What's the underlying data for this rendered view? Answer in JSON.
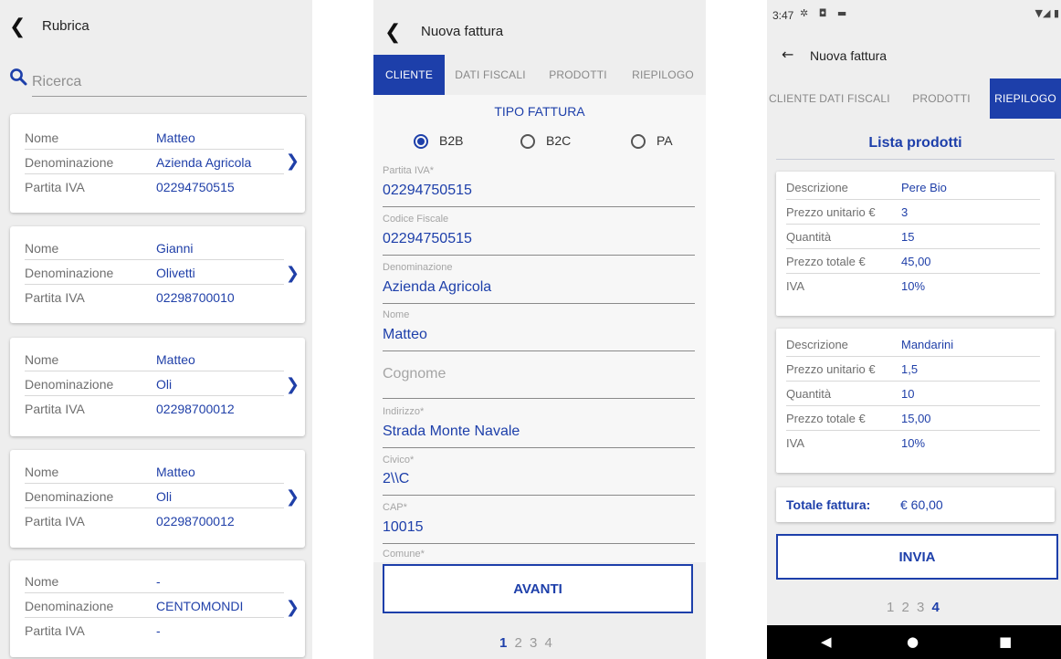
{
  "rubrica": {
    "title": "Rubrica",
    "search": {
      "placeholder": "Ricerca",
      "value": ""
    },
    "labels": {
      "nome": "Nome",
      "denominazione": "Denominazione",
      "partita_iva": "Partita IVA"
    },
    "contacts": [
      {
        "nome": "Matteo",
        "denominazione": "Azienda Agricola",
        "partita_iva": "02294750515"
      },
      {
        "nome": "Gianni",
        "denominazione": "Olivetti",
        "partita_iva": "02298700010"
      },
      {
        "nome": "Matteo",
        "denominazione": "Oli",
        "partita_iva": "02298700012"
      },
      {
        "nome": "Matteo",
        "denominazione": "Oli",
        "partita_iva": "02298700012"
      },
      {
        "nome": "-",
        "denominazione": "CENTOMONDI",
        "partita_iva": "-"
      }
    ]
  },
  "cliente_screen": {
    "title": "Nuova fattura",
    "tabs": [
      "CLIENTE",
      "DATI FISCALI",
      "PRODOTTI",
      "RIEPILOGO"
    ],
    "active_tab": "CLIENTE",
    "section_title": "TIPO FATTURA",
    "tipo_options": [
      "B2B",
      "B2C",
      "PA"
    ],
    "tipo_selected": "B2B",
    "fields": {
      "partita_iva": {
        "label": "Partita IVA*",
        "value": "02294750515"
      },
      "codice_fiscale": {
        "label": "Codice Fiscale",
        "value": "02294750515"
      },
      "denominazione": {
        "label": "Denominazione",
        "value": "Azienda Agricola"
      },
      "nome": {
        "label": "Nome",
        "value": "Matteo"
      },
      "cognome": {
        "placeholder": "Cognome",
        "value": ""
      },
      "indirizzo": {
        "label": "Indirizzo*",
        "value": "Strada Monte Navale"
      },
      "civico": {
        "label": "Civico*",
        "value": "2\\\\C"
      },
      "cap": {
        "label": "CAP*",
        "value": "10015"
      },
      "comune": {
        "label": "Comune*",
        "value": ""
      }
    },
    "avanti_label": "AVANTI",
    "pager": {
      "pages": [
        "1",
        "2",
        "3",
        "4"
      ],
      "current": "1"
    }
  },
  "riepilogo_screen": {
    "status_time": "3:47",
    "status_icons": "✲ ◘ ▬",
    "status_right": "▼◢ ▮",
    "title": "Nuova fattura",
    "tabs": [
      "CLIENTE",
      "DATI FISCALI",
      "PRODOTTI",
      "RIEPILOGO"
    ],
    "active_tab": "RIEPILOGO",
    "lista_title": "Lista prodotti",
    "labels": {
      "descrizione": "Descrizione",
      "prezzo_unitario": "Prezzo unitario €",
      "quantita": "Quantità",
      "prezzo_totale": "Prezzo totale €",
      "iva": "IVA"
    },
    "products": [
      {
        "descrizione": "Pere Bio",
        "prezzo_unitario": "3",
        "quantita": "15",
        "prezzo_totale": "45,00",
        "iva": "10%"
      },
      {
        "descrizione": "Mandarini",
        "prezzo_unitario": "1,5",
        "quantita": "10",
        "prezzo_totale": "15,00",
        "iva": "10%"
      }
    ],
    "totale_label": "Totale fattura:",
    "totale_value": "€ 60,00",
    "invia_label": "INVIA",
    "pager": {
      "pages": [
        "1",
        "2",
        "3",
        "4"
      ],
      "current": "4"
    }
  },
  "colors": {
    "accent": "#1d3faa",
    "label_gray": "#6f6f6f",
    "background": "#eeeeee"
  },
  "icons": {
    "back": "chevron-left-icon",
    "search": "search-icon",
    "card_arrow": "chevron-right-icon",
    "android_back": "triangle-back-icon",
    "android_home": "circle-home-icon",
    "android_recent": "square-recents-icon"
  }
}
